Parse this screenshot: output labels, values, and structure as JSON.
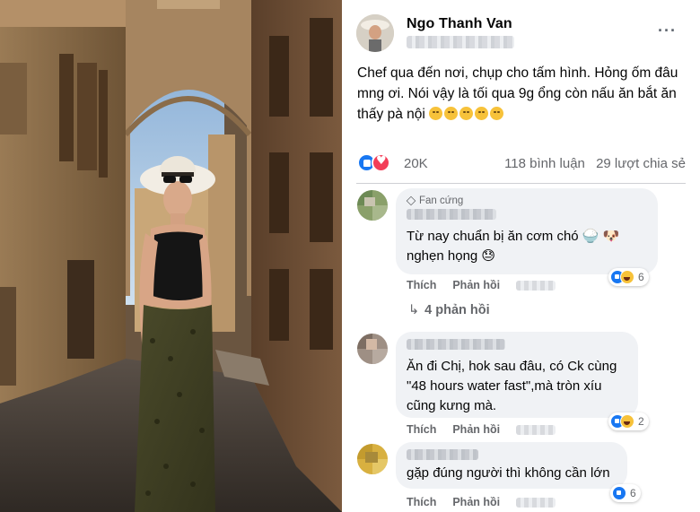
{
  "post": {
    "author": "Ngo Thanh Van",
    "more_label": "···",
    "caption": "Chef qua đến nơi, chụp cho tấm hình. Hỏng ốm đâu mng ơi. Nói vậy là tối qua 9g ổng còn nấu ăn bắt ăn thấy pà nội",
    "caption_emojis": [
      "upside-down-face",
      "upside-down-face",
      "grimacing-face",
      "open-hands-face",
      "grimacing-face"
    ],
    "reactions": {
      "icons": [
        "like-icon",
        "love-icon"
      ],
      "count": "20K"
    },
    "comments_count": "118 bình luận",
    "shares_count": "29 lượt chia sẻ"
  },
  "comments": [
    {
      "badge": "Fan cứng",
      "text": "Từ nay chuẩn bị ăn cơm chó 🍚 🐶 nghẹn họng 😓",
      "like_label": "Thích",
      "reply_label": "Phản hồi",
      "reaction_count": "6",
      "replies_label": "4 phản hồi"
    },
    {
      "text": "Ăn đi Chị, hok sau đâu, có Ck cùng \"48 hours water fast\",mà tròn xíu cũng kưng mà.",
      "like_label": "Thích",
      "reply_label": "Phản hồi",
      "reaction_count": "2"
    },
    {
      "text": "gặp đúng người thì không cần lớn",
      "like_label": "Thích",
      "reply_label": "Phản hồi",
      "reaction_count": "6"
    }
  ],
  "colors": {
    "like_blue": "#1877f2",
    "love_red": "#f33e58",
    "bubble_gray": "#f0f2f5",
    "meta_gray": "#65676b"
  }
}
